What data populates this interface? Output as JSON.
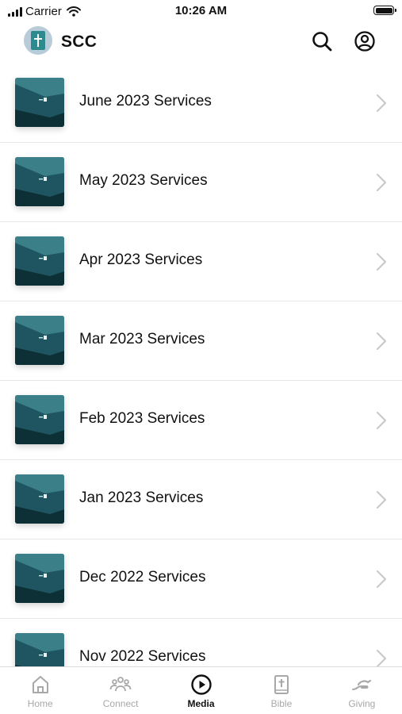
{
  "status_bar": {
    "carrier": "Carrier",
    "time": "10:26 AM"
  },
  "header": {
    "title": "SCC",
    "logo_icon": "cross-bible-logo",
    "search_icon": "search-icon",
    "account_icon": "user-circle-icon"
  },
  "items": [
    {
      "label": "June 2023 Services"
    },
    {
      "label": "May 2023 Services"
    },
    {
      "label": "Apr 2023 Services"
    },
    {
      "label": "Mar 2023 Services"
    },
    {
      "label": "Feb 2023 Services"
    },
    {
      "label": "Jan 2023 Services"
    },
    {
      "label": "Dec 2022 Services"
    },
    {
      "label": "Nov 2022 Services"
    }
  ],
  "tabs": [
    {
      "label": "Home",
      "icon": "home-icon",
      "active": false
    },
    {
      "label": "Connect",
      "icon": "people-icon",
      "active": false
    },
    {
      "label": "Media",
      "icon": "play-circle-icon",
      "active": true
    },
    {
      "label": "Bible",
      "icon": "bible-icon",
      "active": false
    },
    {
      "label": "Giving",
      "icon": "giving-hand-icon",
      "active": false
    }
  ],
  "colors": {
    "thumbnail_teal": "#2e6f78",
    "active_tab": "#111111",
    "inactive_tab": "#a8a8a8"
  }
}
